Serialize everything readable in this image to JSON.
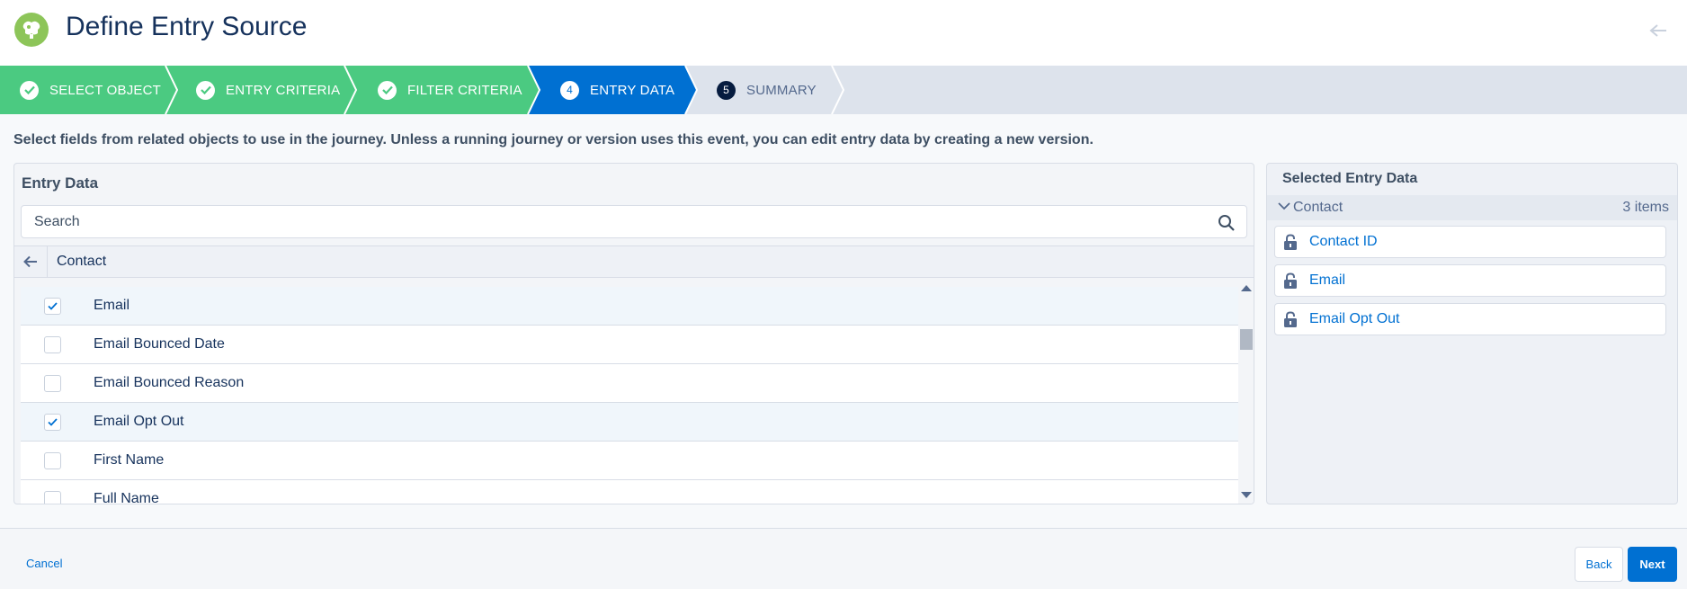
{
  "header": {
    "title": "Define Entry Source",
    "app_icon": "journey-icon",
    "back_icon": "arrow-left-icon"
  },
  "path": {
    "steps": [
      {
        "label": "SELECT OBJECT",
        "state": "complete"
      },
      {
        "label": "ENTRY CRITERIA",
        "state": "complete"
      },
      {
        "label": "FILTER CRITERIA",
        "state": "complete"
      },
      {
        "label": "ENTRY DATA",
        "state": "current",
        "number": "4"
      },
      {
        "label": "SUMMARY",
        "state": "incomplete",
        "number": "5"
      }
    ]
  },
  "instruction": "Select fields from related objects to use in the journey. Unless a running journey or version uses this event, you can edit entry data by creating a new version.",
  "entry_data": {
    "title": "Entry Data",
    "search_placeholder": "Search",
    "breadcrumb": "Contact",
    "fields": [
      {
        "label": "Email",
        "checked": true
      },
      {
        "label": "Email Bounced Date",
        "checked": false
      },
      {
        "label": "Email Bounced Reason",
        "checked": false
      },
      {
        "label": "Email Opt Out",
        "checked": true
      },
      {
        "label": "First Name",
        "checked": false
      },
      {
        "label": "Full Name",
        "checked": false
      }
    ]
  },
  "selected_entry_data": {
    "title": "Selected Entry Data",
    "group": {
      "label": "Contact",
      "count": "3 items"
    },
    "items": [
      {
        "label": "Contact ID"
      },
      {
        "label": "Email"
      },
      {
        "label": "Email Opt Out"
      }
    ]
  },
  "footer": {
    "cancel_label": "Cancel",
    "back_label": "Back",
    "next_label": "Next"
  },
  "colors": {
    "complete": "#4bca81",
    "current": "#0070d2",
    "incomplete": "#dde3ec",
    "link": "#0070d2"
  }
}
